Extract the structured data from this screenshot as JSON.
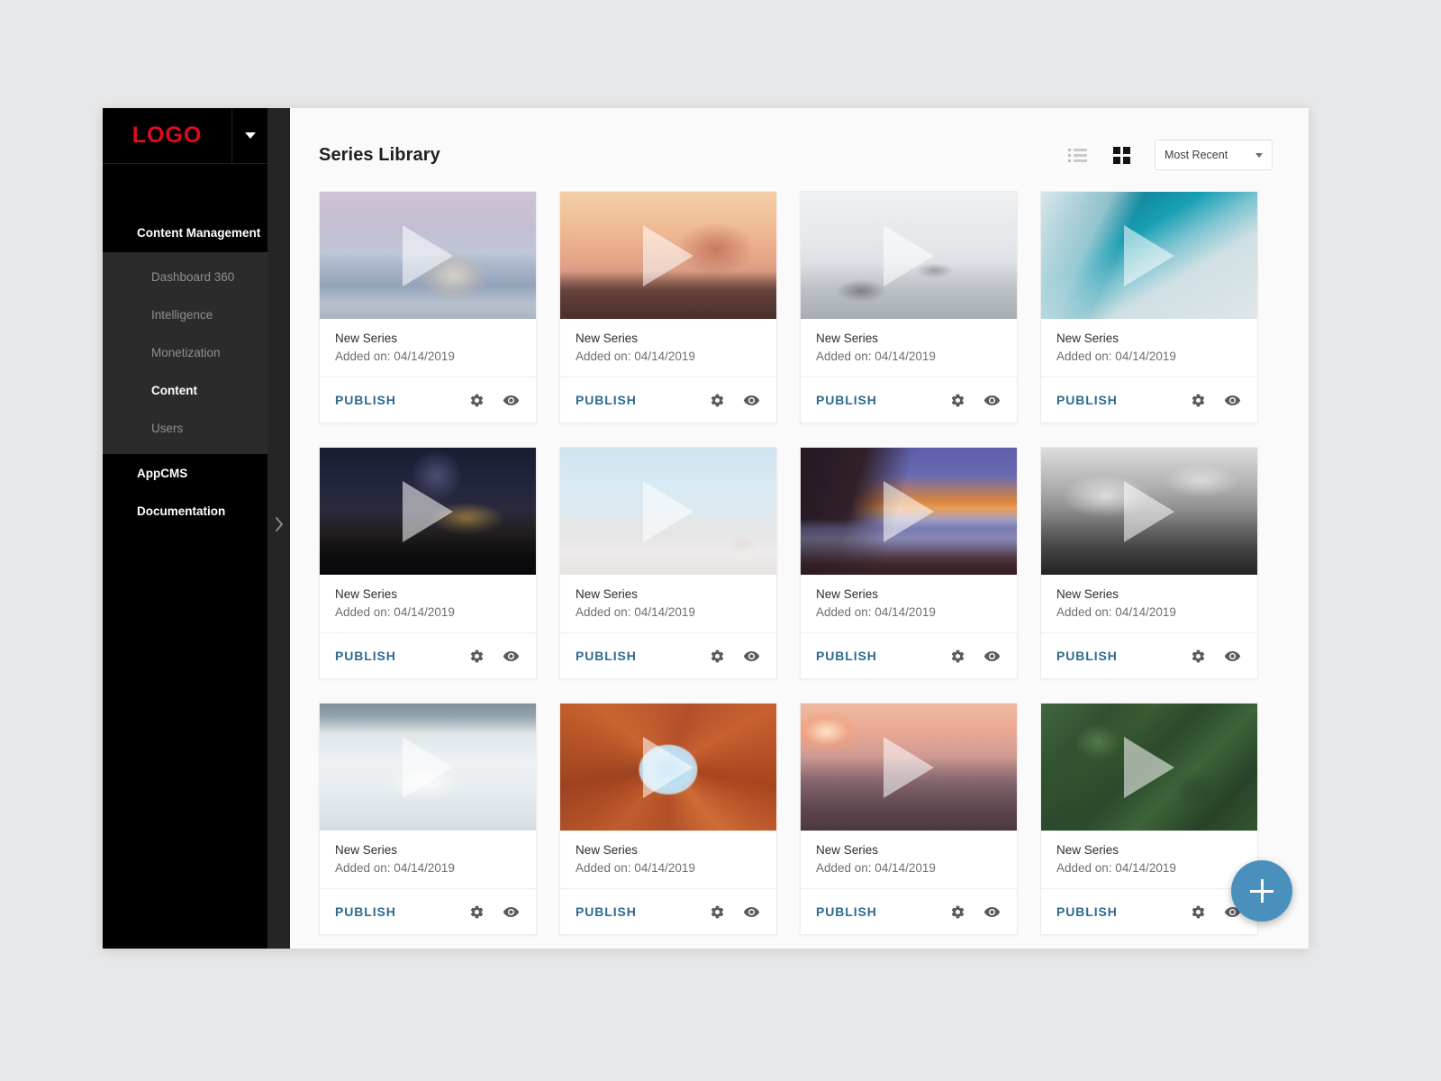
{
  "sidebar": {
    "logo": "LOGO",
    "caret_icon": "caret-down-icon",
    "group_label": "Content Management",
    "sub_items": [
      {
        "label": "Dashboard 360",
        "active": false
      },
      {
        "label": "Intelligence",
        "active": false
      },
      {
        "label": "Monetization",
        "active": false
      },
      {
        "label": "Content",
        "active": true
      },
      {
        "label": "Users",
        "active": false
      }
    ],
    "items": [
      {
        "label": "AppCMS"
      },
      {
        "label": "Documentation"
      }
    ],
    "toggle_icon": "chevron-right-icon"
  },
  "header": {
    "title": "Series Library",
    "list_view_icon": "list-view-icon",
    "grid_view_icon": "grid-view-icon",
    "sort": {
      "value": "Most Recent",
      "caret_icon": "chevron-down-icon",
      "options": [
        "Most Recent"
      ]
    }
  },
  "card_defaults": {
    "title": "New Series",
    "meta": "Added on: 04/14/2019",
    "publish_label": "PUBLISH",
    "settings_icon": "gear-icon",
    "preview_icon": "eye-icon",
    "play_icon": "play-triangle-icon"
  },
  "cards": [
    {
      "title": "New Series",
      "meta": "Added on: 04/14/2019",
      "publish_label": "PUBLISH",
      "art": "img-wolf",
      "alt": "white wolf on icy shore"
    },
    {
      "title": "New Series",
      "meta": "Added on: 04/14/2019",
      "publish_label": "PUBLISH",
      "art": "img-bridge",
      "alt": "golden gate bridge at sunset"
    },
    {
      "title": "New Series",
      "meta": "Added on: 04/14/2019",
      "publish_label": "PUBLISH",
      "art": "img-snow",
      "alt": "snowy mountain slope"
    },
    {
      "title": "New Series",
      "meta": "Added on: 04/14/2019",
      "publish_label": "PUBLISH",
      "art": "img-wave",
      "alt": "teal breaking ocean wave"
    },
    {
      "title": "New Series",
      "meta": "Added on: 04/14/2019",
      "publish_label": "PUBLISH",
      "art": "img-stars",
      "alt": "milky way over mountain lake"
    },
    {
      "title": "New Series",
      "meta": "Added on: 04/14/2019",
      "publish_label": "PUBLISH",
      "art": "img-santorini",
      "alt": "white santorini village"
    },
    {
      "title": "New Series",
      "meta": "Added on: 04/14/2019",
      "publish_label": "PUBLISH",
      "art": "img-cloudsea",
      "alt": "sunset above sea of clouds"
    },
    {
      "title": "New Series",
      "meta": "Added on: 04/14/2019",
      "publish_label": "PUBLISH",
      "art": "img-mist",
      "alt": "black and white misty mountains"
    },
    {
      "title": "New Series",
      "meta": "Added on: 04/14/2019",
      "publish_label": "PUBLISH",
      "art": "img-book",
      "alt": "open book with glasses on bed"
    },
    {
      "title": "New Series",
      "meta": "Added on: 04/14/2019",
      "publish_label": "PUBLISH",
      "art": "img-courtyard",
      "alt": "orange building courtyard looking up"
    },
    {
      "title": "New Series",
      "meta": "Added on: 04/14/2019",
      "publish_label": "PUBLISH",
      "art": "img-city",
      "alt": "aerial city at sunset"
    },
    {
      "title": "New Series",
      "meta": "Added on: 04/14/2019",
      "publish_label": "PUBLISH",
      "art": "img-forest",
      "alt": "aerial green forest canopy"
    }
  ],
  "fab": {
    "icon": "plus-icon",
    "label": "+"
  },
  "colors": {
    "logo_red": "#e00a1e",
    "sidebar_black": "#000000",
    "sidebar_sub": "#2b2b2b",
    "publish_blue": "#2e6b8f",
    "fab_blue": "#4a90bd",
    "page_bg": "#e6e8ea"
  }
}
